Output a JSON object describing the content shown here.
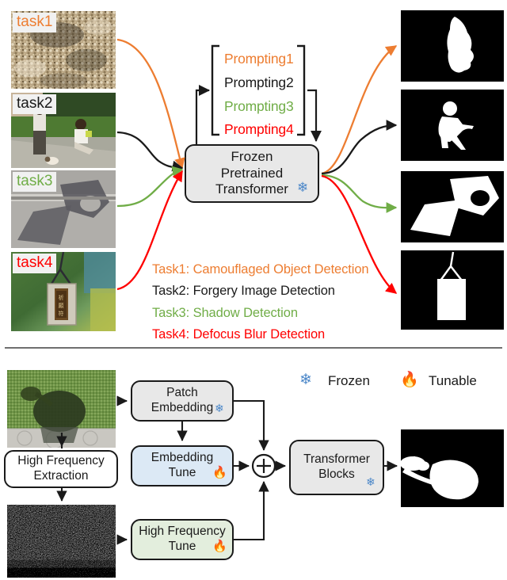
{
  "figure": {
    "top_section": {
      "inputs": [
        {
          "tag": "task1",
          "tag_color": "#ed7d31",
          "image": "camouflaged-gravel-texture"
        },
        {
          "tag": "task2",
          "tag_color": "#1a1a1a",
          "image": "forgery-children-playground"
        },
        {
          "tag": "task3",
          "tag_color": "#70ad47",
          "image": "shadow-on-pavement"
        },
        {
          "tag": "task4",
          "tag_color": "#ff0000",
          "image": "defocus-hanging-plaque"
        }
      ],
      "prompting": [
        {
          "label": "Prompting1",
          "color": "#ed7d31"
        },
        {
          "label": "Prompting2",
          "color": "#1a1a1a"
        },
        {
          "label": "Prompting3",
          "color": "#70ad47"
        },
        {
          "label": "Prompting4",
          "color": "#ff0000"
        }
      ],
      "model_box": {
        "lines": [
          "Frozen",
          "Pretrained",
          "Transformer"
        ],
        "icon": "snowflake-icon",
        "fill": "#e8e8e8"
      },
      "task_captions": [
        {
          "label": "Task1: Camouflaged Object Detection",
          "color": "#ed7d31"
        },
        {
          "label": "Task2: Forgery Image Detection",
          "color": "#1a1a1a"
        },
        {
          "label": "Task3: Shadow Detection",
          "color": "#70ad47"
        },
        {
          "label": "Task4: Defocus Blur Detection",
          "color": "#ff0000"
        }
      ],
      "outputs": [
        {
          "name": "mask-leaf-shape",
          "arrow_color": "#ed7d31"
        },
        {
          "name": "mask-child-figure",
          "arrow_color": "#1a1a1a"
        },
        {
          "name": "mask-shadow-region",
          "arrow_color": "#70ad47"
        },
        {
          "name": "mask-plaque-rect",
          "arrow_color": "#ff0000"
        }
      ]
    },
    "bottom_section": {
      "input_image": "shadow-bush-on-grass",
      "hf_image": "high-frequency-noise-map",
      "blocks": [
        {
          "lines": [
            "Patch",
            "Embedding"
          ],
          "icon": "snowflake-icon",
          "fill": "#e8e8e8"
        },
        {
          "lines": [
            "Embedding",
            "Tune"
          ],
          "icon": "flame-icon",
          "fill": "#dce9f5"
        },
        {
          "lines": [
            "High Frequency",
            "Tune"
          ],
          "icon": "flame-icon",
          "fill": "#e3eedd"
        },
        {
          "lines": [
            "Transformer",
            "Blocks"
          ],
          "icon": "snowflake-icon",
          "fill": "#e8e8e8"
        }
      ],
      "extraction_box": {
        "lines": [
          "High Frequency",
          "Extraction"
        ],
        "fill": "#ffffff"
      },
      "sum_node": {
        "symbol": "+"
      },
      "output_mask": "mask-shadow-bush",
      "legend": [
        {
          "icon": "snowflake-icon",
          "label": "Frozen",
          "color": "#4a86c8"
        },
        {
          "icon": "flame-icon",
          "label": "Tunable",
          "color": "#ff6a1a"
        }
      ]
    }
  }
}
